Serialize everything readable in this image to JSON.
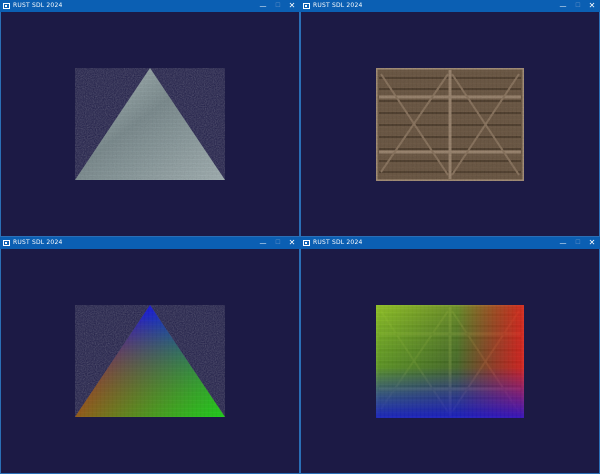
{
  "windows": [
    {
      "title": "RUST SDL 2024",
      "controls": {
        "minimize": "—",
        "maximize": "☐",
        "close": "✕"
      },
      "content": "gray-textured-triangle"
    },
    {
      "title": "RUST SDL 2024",
      "controls": {
        "minimize": "—",
        "maximize": "☐",
        "close": "✕"
      },
      "content": "wooden-crate-texture"
    },
    {
      "title": "RUST SDL 2024",
      "controls": {
        "minimize": "—",
        "maximize": "☐",
        "close": "✕"
      },
      "content": "vertex-colored-textured-triangle"
    },
    {
      "title": "RUST SDL 2024",
      "controls": {
        "minimize": "—",
        "maximize": "☐",
        "close": "✕"
      },
      "content": "vertex-colored-crate-texture"
    }
  ],
  "colors": {
    "titlebar": "#0b5fb3",
    "client_background": "#1c1a45",
    "triangle_gray": "#8a9a9c",
    "crate_wood": "#6e5a46"
  }
}
